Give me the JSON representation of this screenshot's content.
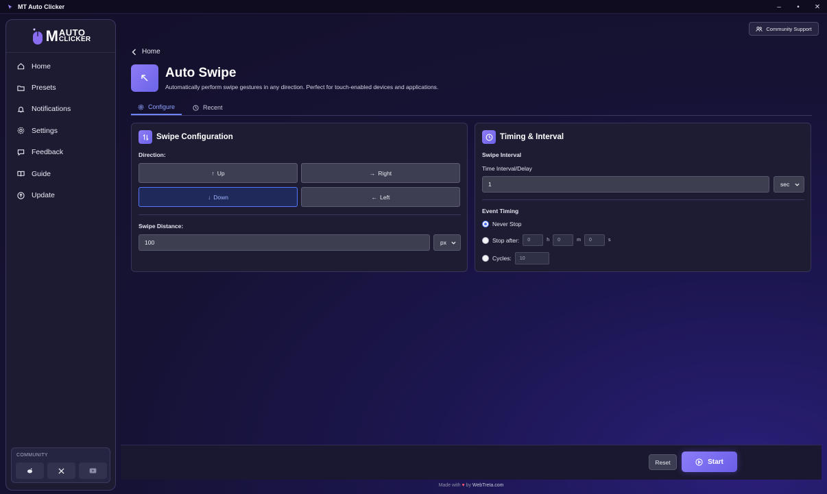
{
  "window": {
    "title": "MT Auto Clicker",
    "minimize": "–",
    "maximize": "•",
    "close": "✕"
  },
  "logo": {
    "mark": "M",
    "line1": "AUTO",
    "line2": "CLICKER"
  },
  "sidebar": {
    "items": [
      {
        "label": "Home",
        "icon": "home-icon"
      },
      {
        "label": "Presets",
        "icon": "folder-icon"
      },
      {
        "label": "Notifications",
        "icon": "bell-icon"
      },
      {
        "label": "Settings",
        "icon": "gear-icon"
      },
      {
        "label": "Feedback",
        "icon": "chat-icon"
      },
      {
        "label": "Guide",
        "icon": "book-icon"
      },
      {
        "label": "Update",
        "icon": "arrow-up-circle-icon"
      }
    ],
    "community_label": "COMMUNITY"
  },
  "header": {
    "community_support": "Community Support",
    "breadcrumb": "Home",
    "title": "Auto Swipe",
    "description": "Automatically perform swipe gestures in any direction. Perfect for touch-enabled devices and applications."
  },
  "tabs": [
    {
      "label": "Configure",
      "active": true
    },
    {
      "label": "Recent",
      "active": false
    }
  ],
  "swipe_config": {
    "title": "Swipe Configuration",
    "direction_label": "Direction:",
    "directions": [
      {
        "label": "Up",
        "arrow": "↑",
        "selected": false
      },
      {
        "label": "Right",
        "arrow": "→",
        "selected": false
      },
      {
        "label": "Down",
        "arrow": "↓",
        "selected": true
      },
      {
        "label": "Left",
        "arrow": "←",
        "selected": false
      }
    ],
    "distance_label": "Swipe Distance:",
    "distance_value": "100",
    "distance_unit": "px"
  },
  "timing": {
    "title": "Timing & Interval",
    "interval_section": "Swipe Interval",
    "interval_label": "Time Interval/Delay",
    "interval_value": "1",
    "interval_unit": "sec",
    "event_section": "Event Timing",
    "never_stop": "Never Stop",
    "stop_after": "Stop after:",
    "stop_h": "0",
    "stop_m": "0",
    "stop_s": "0",
    "unit_h": "h",
    "unit_m": "m",
    "unit_s": "s",
    "cycles": "Cycles:",
    "cycles_value": "10",
    "selected": "never_stop"
  },
  "actions": {
    "reset": "Reset",
    "start": "Start"
  },
  "footer": {
    "made_with": "Made with",
    "heart": "♥",
    "by": "by",
    "brand": "WebTreta.com"
  },
  "colors": {
    "accent": "#6d84ff",
    "primary_button": "#7b6ff2",
    "heart": "#ff5a7a"
  }
}
